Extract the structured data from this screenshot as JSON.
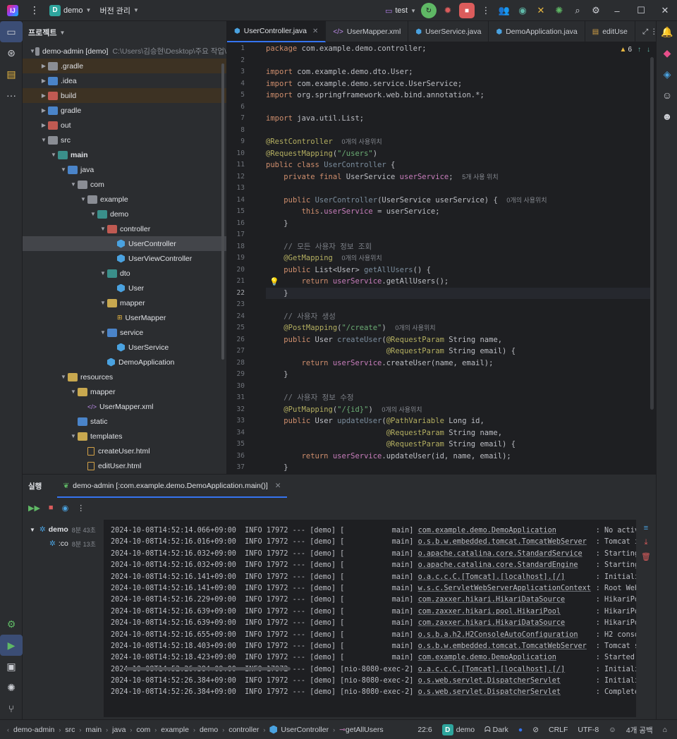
{
  "titlebar": {
    "project_name": "demo",
    "project_badge": "D",
    "vcs_label": "버전 관리",
    "run_config": "test"
  },
  "project_panel": {
    "title": "프로젝트",
    "tree": [
      {
        "label": "demo-admin [demo]",
        "path": "C:\\Users\\김승현\\Desktop\\주요 작업\\",
        "indent": 1,
        "arrow": "down",
        "icon": "module"
      },
      {
        "label": ".gradle",
        "indent": 2,
        "arrow": "right",
        "icon": "folder",
        "excluded": true
      },
      {
        "label": ".idea",
        "indent": 2,
        "arrow": "right",
        "icon": "folder-blue"
      },
      {
        "label": "build",
        "indent": 2,
        "arrow": "right",
        "icon": "folder-red",
        "excluded": true
      },
      {
        "label": "gradle",
        "indent": 2,
        "arrow": "right",
        "icon": "folder-blue"
      },
      {
        "label": "out",
        "indent": 2,
        "arrow": "right",
        "icon": "folder-red"
      },
      {
        "label": "src",
        "indent": 2,
        "arrow": "down",
        "icon": "folder"
      },
      {
        "label": "main",
        "indent": 3,
        "arrow": "down",
        "icon": "folder-src",
        "bold": true
      },
      {
        "label": "java",
        "indent": 4,
        "arrow": "down",
        "icon": "folder-blue"
      },
      {
        "label": "com",
        "indent": 5,
        "arrow": "down",
        "icon": "folder"
      },
      {
        "label": "example",
        "indent": 6,
        "arrow": "down",
        "icon": "folder"
      },
      {
        "label": "demo",
        "indent": 7,
        "arrow": "down",
        "icon": "folder-src"
      },
      {
        "label": "controller",
        "indent": 8,
        "arrow": "down",
        "icon": "folder-red"
      },
      {
        "label": "UserController",
        "indent": 9,
        "arrow": "",
        "icon": "class",
        "selected": true
      },
      {
        "label": "UserViewController",
        "indent": 9,
        "arrow": "",
        "icon": "class"
      },
      {
        "label": "dto",
        "indent": 8,
        "arrow": "down",
        "icon": "folder-src"
      },
      {
        "label": "User",
        "indent": 9,
        "arrow": "",
        "icon": "class"
      },
      {
        "label": "mapper",
        "indent": 8,
        "arrow": "down",
        "icon": "folder-yellow"
      },
      {
        "label": "UserMapper",
        "indent": 9,
        "arrow": "",
        "icon": "mapper"
      },
      {
        "label": "service",
        "indent": 8,
        "arrow": "down",
        "icon": "folder-blue"
      },
      {
        "label": "UserService",
        "indent": 9,
        "arrow": "",
        "icon": "class"
      },
      {
        "label": "DemoApplication",
        "indent": 8,
        "arrow": "",
        "icon": "class"
      },
      {
        "label": "resources",
        "indent": 4,
        "arrow": "down",
        "icon": "folder-yellow"
      },
      {
        "label": "mapper",
        "indent": 5,
        "arrow": "down",
        "icon": "folder-yellow"
      },
      {
        "label": "UserMapper.xml",
        "indent": 6,
        "arrow": "",
        "icon": "xml"
      },
      {
        "label": "static",
        "indent": 5,
        "arrow": "",
        "icon": "folder-blue"
      },
      {
        "label": "templates",
        "indent": 5,
        "arrow": "down",
        "icon": "folder-yellow"
      },
      {
        "label": "createUser.html",
        "indent": 6,
        "arrow": "",
        "icon": "html"
      },
      {
        "label": "editUser.html",
        "indent": 6,
        "arrow": "",
        "icon": "html"
      }
    ]
  },
  "editor": {
    "tabs": [
      {
        "label": "UserController.java",
        "icon": "class",
        "active": true,
        "closable": true
      },
      {
        "label": "UserMapper.xml",
        "icon": "xml"
      },
      {
        "label": "UserService.java",
        "icon": "class"
      },
      {
        "label": "DemoApplication.java",
        "icon": "class"
      },
      {
        "label": "editUse",
        "icon": "html"
      }
    ],
    "warning_count": "6",
    "current_line": 22,
    "lines": [
      {
        "n": "1",
        "html": "<span class='kw'>package</span> com.example.demo.controller;"
      },
      {
        "n": "2",
        "html": ""
      },
      {
        "n": "3",
        "html": "<span class='kw'>import</span> com.example.demo.dto.User;"
      },
      {
        "n": "4",
        "html": "<span class='kw'>import</span> com.example.demo.service.UserService;"
      },
      {
        "n": "5",
        "html": "<span class='kw'>import</span> org.springframework.web.bind.annotation.*;"
      },
      {
        "n": "6",
        "html": ""
      },
      {
        "n": "7",
        "html": "<span class='kw'>import</span> java.util.List;"
      },
      {
        "n": "8",
        "html": ""
      },
      {
        "n": "9",
        "html": "<span class='ann'>@RestController</span>  <span class='hint'>0개의 사용위치</span>"
      },
      {
        "n": "10",
        "html": "<span class='ann'>@RequestMapping</span>(<span class='str'>\"/users\"</span>)"
      },
      {
        "n": "11",
        "html": "<span class='kw'>public class</span> <span class='unused'>UserController</span> {"
      },
      {
        "n": "12",
        "html": "    <span class='kw'>private final</span> UserService <span class='fld'>userService</span>;  <span class='hint'>5개 사용 위치</span>"
      },
      {
        "n": "13",
        "html": ""
      },
      {
        "n": "14",
        "html": "    <span class='kw'>public</span> <span class='unused'>UserController</span>(UserService userService) {  <span class='hint'>0개의 사용위치</span>"
      },
      {
        "n": "15",
        "html": "        <span class='kw'>this</span>.<span class='fld'>userService</span> = userService;"
      },
      {
        "n": "16",
        "html": "    }"
      },
      {
        "n": "17",
        "html": ""
      },
      {
        "n": "18",
        "html": "    <span class='cmt'>// 모든 사용자 정보 조회</span>"
      },
      {
        "n": "19",
        "html": "    <span class='ann'>@GetMapping</span>  <span class='hint'>0개의 사용위치</span>"
      },
      {
        "n": "20",
        "html": "    <span class='kw'>public</span> List&lt;User&gt; <span class='unused'>getAllUsers</span>() {"
      },
      {
        "n": "21",
        "html": "        <span class='kw'>return</span> <span class='fld'>userService</span>.getAllUsers();"
      },
      {
        "n": "22",
        "html": "    }"
      },
      {
        "n": "23",
        "html": ""
      },
      {
        "n": "24",
        "html": "    <span class='cmt'>// 사용자 생성</span>"
      },
      {
        "n": "25",
        "html": "    <span class='ann'>@PostMapping</span>(<span class='str'>\"/create\"</span>)  <span class='hint'>0개의 사용위치</span>"
      },
      {
        "n": "26",
        "html": "    <span class='kw'>public</span> User <span class='unused'>createUser</span>(<span class='ann'>@RequestParam</span> String name,"
      },
      {
        "n": "27",
        "html": "                           <span class='ann'>@RequestParam</span> String email) {"
      },
      {
        "n": "28",
        "html": "        <span class='kw'>return</span> <span class='fld'>userService</span>.createUser(name, email);"
      },
      {
        "n": "29",
        "html": "    }"
      },
      {
        "n": "30",
        "html": ""
      },
      {
        "n": "31",
        "html": "    <span class='cmt'>// 사용자 정보 수정</span>"
      },
      {
        "n": "32",
        "html": "    <span class='ann'>@PutMapping</span>(<span class='str'>\"/{id}\"</span>)  <span class='hint'>0개의 사용위치</span>"
      },
      {
        "n": "33",
        "html": "    <span class='kw'>public</span> User <span class='unused'>updateUser</span>(<span class='ann'>@PathVariable</span> Long id,"
      },
      {
        "n": "34",
        "html": "                           <span class='ann'>@RequestParam</span> String name,"
      },
      {
        "n": "35",
        "html": "                           <span class='ann'>@RequestParam</span> String email) {"
      },
      {
        "n": "36",
        "html": "        <span class='kw'>return</span> <span class='fld'>userService</span>.updateUser(id, name, email);"
      },
      {
        "n": "37",
        "html": "    }"
      }
    ]
  },
  "run_panel": {
    "title": "실행",
    "tab_label": "demo-admin [:com.example.demo.DemoApplication.main()]",
    "tree": [
      {
        "label": "demo",
        "time": "8분 43초"
      },
      {
        "label": ":co",
        "time": "8분 13초"
      }
    ],
    "logs": [
      {
        "ts": "2024-10-08T14:52:14.066+09:00",
        "lvl": "INFO",
        "pid": "17972",
        "app": "[demo]",
        "thread": "[           main]",
        "logger": "com.example.demo.DemoApplication",
        "msg": ": No active"
      },
      {
        "ts": "2024-10-08T14:52:16.016+09:00",
        "lvl": "INFO",
        "pid": "17972",
        "app": "[demo]",
        "thread": "[           main]",
        "logger": "o.s.b.w.embedded.tomcat.TomcatWebServer",
        "msg": ": Tomcat ini"
      },
      {
        "ts": "2024-10-08T14:52:16.032+09:00",
        "lvl": "INFO",
        "pid": "17972",
        "app": "[demo]",
        "thread": "[           main]",
        "logger": "o.apache.catalina.core.StandardService",
        "msg": ": Starting s"
      },
      {
        "ts": "2024-10-08T14:52:16.032+09:00",
        "lvl": "INFO",
        "pid": "17972",
        "app": "[demo]",
        "thread": "[           main]",
        "logger": "o.apache.catalina.core.StandardEngine",
        "msg": ": Starting S"
      },
      {
        "ts": "2024-10-08T14:52:16.141+09:00",
        "lvl": "INFO",
        "pid": "17972",
        "app": "[demo]",
        "thread": "[           main]",
        "logger": "o.a.c.c.C.[Tomcat].[localhost].[/]",
        "msg": ": Initializ"
      },
      {
        "ts": "2024-10-08T14:52:16.141+09:00",
        "lvl": "INFO",
        "pid": "17972",
        "app": "[demo]",
        "thread": "[           main]",
        "logger": "w.s.c.ServletWebServerApplicationContext",
        "msg": ": Root WebAp"
      },
      {
        "ts": "2024-10-08T14:52:16.229+09:00",
        "lvl": "INFO",
        "pid": "17972",
        "app": "[demo]",
        "thread": "[           main]",
        "logger": "com.zaxxer.hikari.HikariDataSource",
        "msg": ": HikariPool"
      },
      {
        "ts": "2024-10-08T14:52:16.639+09:00",
        "lvl": "INFO",
        "pid": "17972",
        "app": "[demo]",
        "thread": "[           main]",
        "logger": "com.zaxxer.hikari.pool.HikariPool",
        "msg": ": HikariPool"
      },
      {
        "ts": "2024-10-08T14:52:16.639+09:00",
        "lvl": "INFO",
        "pid": "17972",
        "app": "[demo]",
        "thread": "[           main]",
        "logger": "com.zaxxer.hikari.HikariDataSource",
        "msg": ": HikariPool"
      },
      {
        "ts": "2024-10-08T14:52:16.655+09:00",
        "lvl": "INFO",
        "pid": "17972",
        "app": "[demo]",
        "thread": "[           main]",
        "logger": "o.s.b.a.h2.H2ConsoleAutoConfiguration",
        "msg": ": H2 console"
      },
      {
        "ts": "2024-10-08T14:52:18.403+09:00",
        "lvl": "INFO",
        "pid": "17972",
        "app": "[demo]",
        "thread": "[           main]",
        "logger": "o.s.b.w.embedded.tomcat.TomcatWebServer",
        "msg": ": Tomcat sta"
      },
      {
        "ts": "2024-10-08T14:52:18.423+09:00",
        "lvl": "INFO",
        "pid": "17972",
        "app": "[demo]",
        "thread": "[           main]",
        "logger": "com.example.demo.DemoApplication",
        "msg": ": Started De"
      },
      {
        "ts": "2024-10-08T14:52:26.384+09:00",
        "lvl": "INFO",
        "pid": "17972",
        "app": "[demo]",
        "thread": "[nio-8080-exec-2]",
        "logger": "o.a.c.c.C.[Tomcat].[localhost].[/]",
        "msg": ": Initializ"
      },
      {
        "ts": "2024-10-08T14:52:26.384+09:00",
        "lvl": "INFO",
        "pid": "17972",
        "app": "[demo]",
        "thread": "[nio-8080-exec-2]",
        "logger": "o.s.web.servlet.DispatcherServlet",
        "msg": ": Initializ"
      },
      {
        "ts": "2024-10-08T14:52:26.384+09:00",
        "lvl": "INFO",
        "pid": "17972",
        "app": "[demo]",
        "thread": "[nio-8080-exec-2]",
        "logger": "o.s.web.servlet.DispatcherServlet",
        "msg": ": Completed"
      }
    ]
  },
  "statusbar": {
    "breadcrumbs": [
      "demo-admin",
      "src",
      "main",
      "java",
      "com",
      "example",
      "demo",
      "controller",
      "UserController",
      "getAllUsers"
    ],
    "caret": "22:6",
    "project_badge": "D",
    "project": "demo",
    "theme": "Dark",
    "line_sep": "CRLF",
    "encoding": "UTF-8",
    "indent": "4개 공백"
  },
  "colors": {
    "accent": "#3574f0",
    "run_green": "#5fb865",
    "stop_red": "#db5c5c",
    "project_badge": "#2ea59d"
  }
}
